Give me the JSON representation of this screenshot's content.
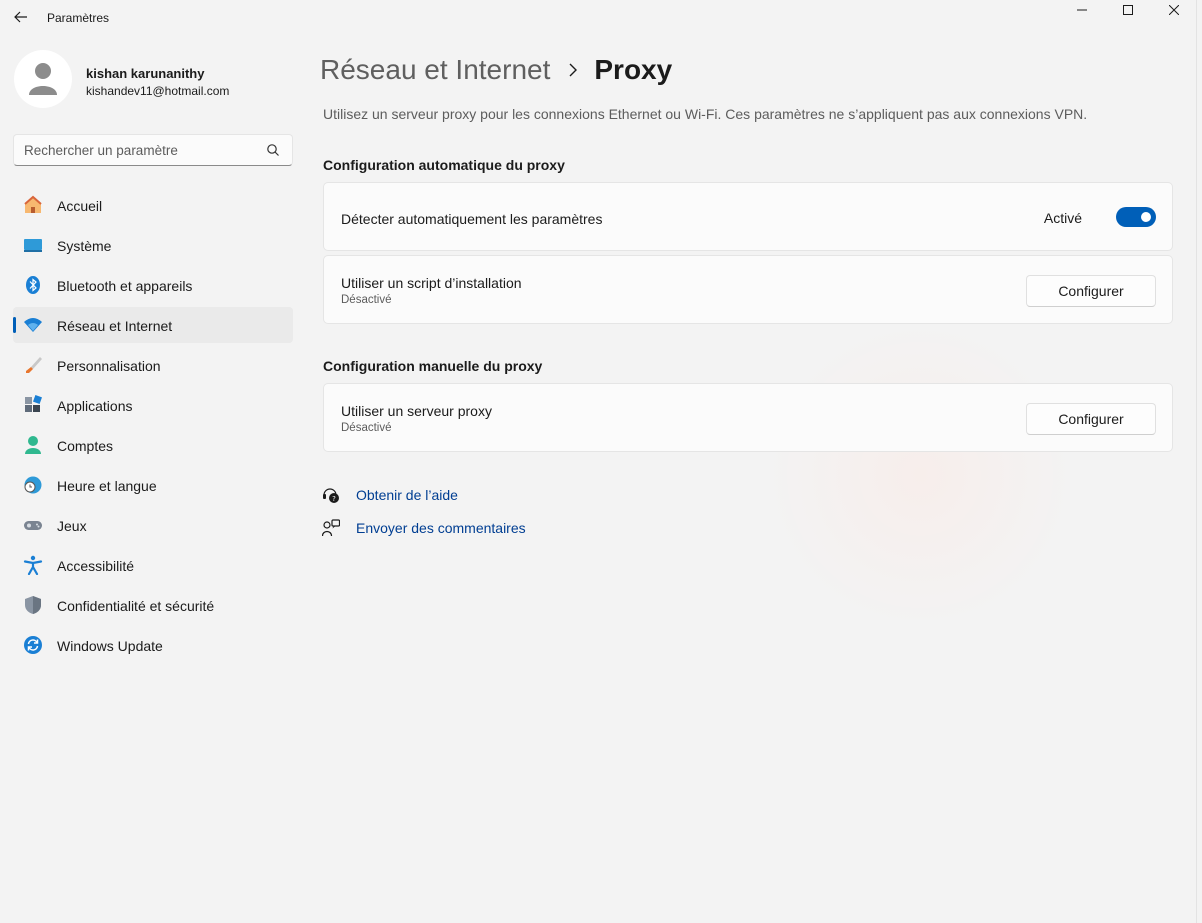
{
  "window": {
    "title": "Paramètres"
  },
  "profile": {
    "name": "kishan karunanithy",
    "email": "kishandev11@hotmail.com"
  },
  "search": {
    "placeholder": "Rechercher un paramètre"
  },
  "sidebar": {
    "items": [
      {
        "label": "Accueil",
        "icon": "home-icon"
      },
      {
        "label": "Système",
        "icon": "system-icon"
      },
      {
        "label": "Bluetooth et appareils",
        "icon": "bluetooth-icon"
      },
      {
        "label": "Réseau et Internet",
        "icon": "wifi-icon",
        "active": true
      },
      {
        "label": "Personnalisation",
        "icon": "brush-icon"
      },
      {
        "label": "Applications",
        "icon": "apps-icon"
      },
      {
        "label": "Comptes",
        "icon": "account-icon"
      },
      {
        "label": "Heure et langue",
        "icon": "time-language-icon"
      },
      {
        "label": "Jeux",
        "icon": "gamepad-icon"
      },
      {
        "label": "Accessibilité",
        "icon": "accessibility-icon"
      },
      {
        "label": "Confidentialité et sécurité",
        "icon": "shield-icon"
      },
      {
        "label": "Windows Update",
        "icon": "update-icon"
      }
    ]
  },
  "main": {
    "breadcrumb_parent": "Réseau et Internet",
    "breadcrumb_current": "Proxy",
    "description": "Utilisez un serveur proxy pour les connexions Ethernet ou Wi-Fi. Ces paramètres ne s’appliquent pas aux connexions VPN.",
    "auto_section": {
      "title": "Configuration automatique du proxy",
      "detect": {
        "label": "Détecter automatiquement les paramètres",
        "state": "Activé",
        "on": true
      },
      "script": {
        "label": "Utiliser un script d’installation",
        "status": "Désactivé",
        "button": "Configurer"
      }
    },
    "manual_section": {
      "title": "Configuration manuelle du proxy",
      "server": {
        "label": "Utiliser un serveur proxy",
        "status": "Désactivé",
        "button": "Configurer"
      }
    },
    "links": {
      "help": "Obtenir de l’aide",
      "feedback": "Envoyer des commentaires"
    }
  },
  "colors": {
    "accent": "#005fb8",
    "link": "#003e92",
    "background": "#f3f3f3"
  }
}
